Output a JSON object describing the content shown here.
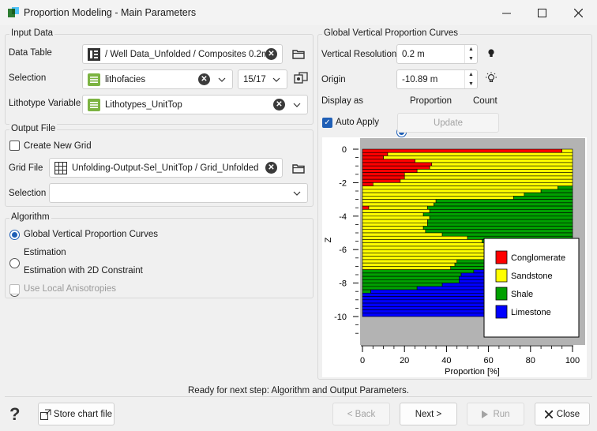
{
  "window": {
    "title": "Proportion Modeling - Main Parameters"
  },
  "input_data": {
    "group_label": "Input Data",
    "data_table_label": "Data Table",
    "data_table_value": "/ Well Data_Unfolded / Composites 0.2m",
    "selection_label": "Selection",
    "selection_value": "lithofacies",
    "selection_count": "15/17",
    "lithotype_label": "Lithotype Variable",
    "lithotype_value": "Lithotypes_UnitTop"
  },
  "output_file": {
    "group_label": "Output File",
    "create_new_grid_label": "Create New Grid",
    "grid_file_label": "Grid File",
    "grid_file_value": "Unfolding-Output-Sel_UnitTop / Grid_Unfolded",
    "selection_label": "Selection",
    "selection_value": ""
  },
  "algorithm": {
    "group_label": "Algorithm",
    "options": [
      "Global Vertical Proportion Curves",
      "Estimation",
      "Estimation with 2D Constraint"
    ],
    "selected_index": 0,
    "local_anisotropies_label": "Use Local Anisotropies"
  },
  "gvpc": {
    "group_label": "Global Vertical Proportion Curves",
    "vertical_resolution_label": "Vertical Resolution",
    "vertical_resolution_value": "0.2 m",
    "origin_label": "Origin",
    "origin_value": "-10.89 m",
    "display_as_label": "Display as",
    "display_options": [
      "Proportion",
      "Count"
    ],
    "display_selected": 0,
    "auto_apply_label": "Auto Apply",
    "update_label": "Update"
  },
  "status": {
    "text": "Ready for next step: Algorithm and Output Parameters."
  },
  "footer": {
    "help_icon": "?",
    "store_chart_label": "Store chart file",
    "back_label": "< Back",
    "next_label": "Next >",
    "run_label": "Run",
    "close_label": "Close"
  },
  "colors": {
    "accent": "#1f5fb6",
    "conglomerate": "#ff0000",
    "sandstone": "#ffff00",
    "shale": "#00a000",
    "limestone": "#0000ff"
  },
  "chart_data": {
    "type": "area",
    "subtype": "stacked-horizontal-bar",
    "xlabel": "Proportion [%]",
    "ylabel": "Z",
    "xlim": [
      0,
      100
    ],
    "ylim": [
      -11,
      0.5
    ],
    "x_ticks": [
      "0",
      "20",
      "40",
      "60",
      "80",
      "100"
    ],
    "y_ticks": [
      "0",
      "-2",
      "-4",
      "-6",
      "-8",
      "-10"
    ],
    "legend_placement": "bottom-right",
    "series": [
      {
        "name": "Conglomerate",
        "color": "#ff0000"
      },
      {
        "name": "Sandstone",
        "color": "#ffff00"
      },
      {
        "name": "Shale",
        "color": "#00a000"
      },
      {
        "name": "Limestone",
        "color": "#0000ff"
      }
    ],
    "z_tops": [
      -0.1,
      -0.3,
      -0.5,
      -0.7,
      -0.9,
      -1.1,
      -1.3,
      -1.5,
      -1.7,
      -1.9,
      -2.1,
      -2.3,
      -2.5,
      -2.7,
      -2.9,
      -3.1,
      -3.3,
      -3.5,
      -3.7,
      -3.9,
      -4.1,
      -4.3,
      -4.5,
      -4.7,
      -4.9,
      -5.1,
      -5.3,
      -5.5,
      -5.7,
      -5.9,
      -6.1,
      -6.3,
      -6.5,
      -6.7,
      -6.9,
      -7.1,
      -7.3,
      -7.5,
      -7.7,
      -7.9,
      -8.1,
      -8.3,
      -8.5,
      -8.7,
      -8.9,
      -9.1,
      -9.3,
      -9.5,
      -9.7,
      -9.9
    ],
    "rows": [
      [
        95,
        5,
        0,
        0
      ],
      [
        12,
        88,
        0,
        0
      ],
      [
        10,
        90,
        0,
        0
      ],
      [
        25,
        75,
        0,
        0
      ],
      [
        33,
        67,
        0,
        0
      ],
      [
        32,
        68,
        0,
        0
      ],
      [
        26,
        74,
        0,
        0
      ],
      [
        20,
        80,
        0,
        0
      ],
      [
        20,
        80,
        0,
        0
      ],
      [
        18,
        82,
        0,
        0
      ],
      [
        5,
        95,
        0,
        0
      ],
      [
        0,
        93,
        7,
        0
      ],
      [
        0,
        85,
        15,
        0
      ],
      [
        0,
        77,
        23,
        0
      ],
      [
        0,
        72,
        28,
        0
      ],
      [
        0,
        35,
        65,
        0
      ],
      [
        0,
        34,
        66,
        0
      ],
      [
        3,
        28,
        69,
        0
      ],
      [
        0,
        32,
        68,
        0
      ],
      [
        0,
        29,
        71,
        0
      ],
      [
        0,
        32,
        68,
        0
      ],
      [
        0,
        31,
        69,
        0
      ],
      [
        0,
        31,
        69,
        0
      ],
      [
        0,
        29,
        71,
        0
      ],
      [
        0,
        30,
        70,
        0
      ],
      [
        0,
        38,
        62,
        0
      ],
      [
        0,
        50,
        50,
        0
      ],
      [
        0,
        57,
        43,
        0
      ],
      [
        0,
        59,
        41,
        0
      ],
      [
        0,
        60,
        40,
        0
      ],
      [
        0,
        62,
        38,
        0
      ],
      [
        0,
        62,
        38,
        0
      ],
      [
        0,
        59,
        41,
        0
      ],
      [
        0,
        45,
        55,
        0
      ],
      [
        0,
        44,
        56,
        0
      ],
      [
        0,
        42,
        58,
        0
      ],
      [
        0,
        0,
        53,
        47
      ],
      [
        0,
        0,
        47,
        53
      ],
      [
        0,
        0,
        46,
        54
      ],
      [
        0,
        0,
        46,
        54
      ],
      [
        0,
        0,
        38,
        62
      ],
      [
        0,
        0,
        26,
        74
      ],
      [
        0,
        0,
        4,
        96
      ],
      [
        0,
        0,
        0,
        100
      ],
      [
        0,
        0,
        0,
        100
      ],
      [
        0,
        0,
        0,
        100
      ],
      [
        0,
        0,
        0,
        100
      ],
      [
        0,
        0,
        0,
        100
      ],
      [
        0,
        0,
        0,
        100
      ],
      [
        0,
        0,
        0,
        100
      ]
    ]
  }
}
